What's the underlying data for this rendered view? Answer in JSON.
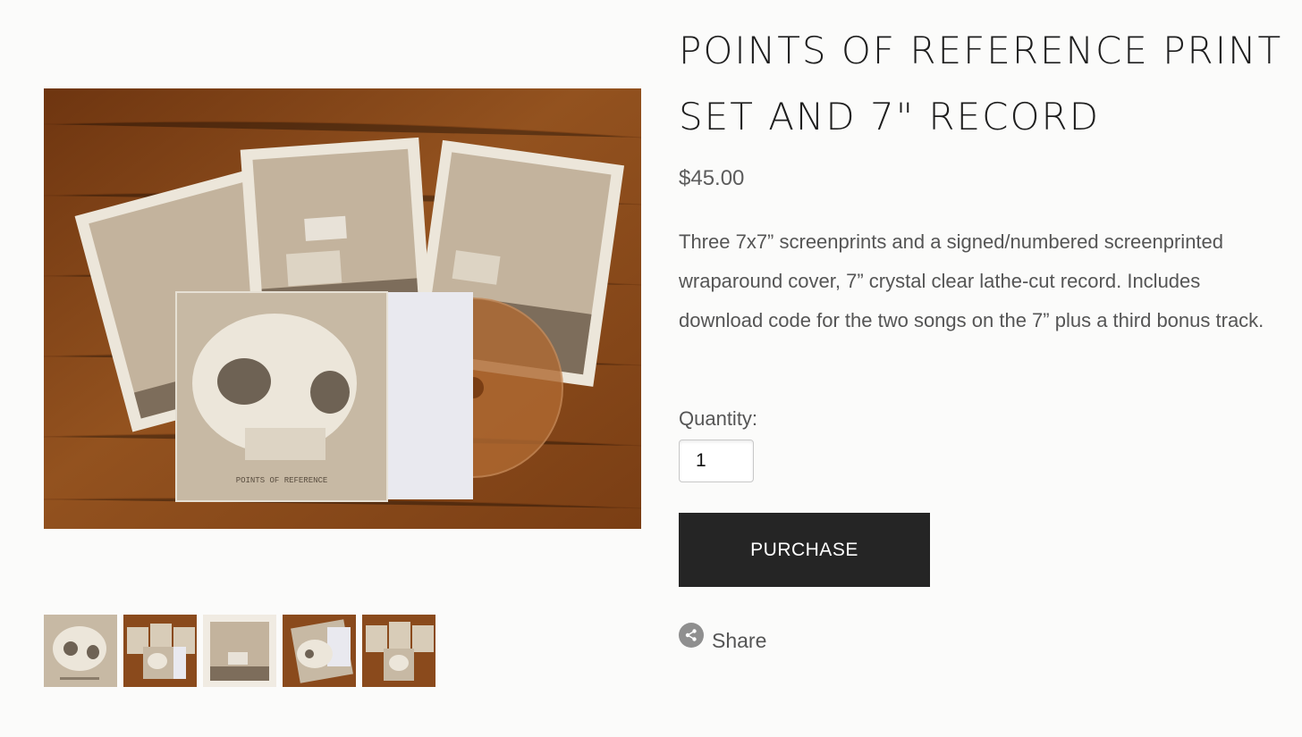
{
  "product": {
    "title": "POINTS OF REFERENCE PRINT SET AND 7\" RECORD",
    "price": "$45.00",
    "description": "Three 7x7” screenprints and a signed/numbered screenprinted wraparound cover, 7” crystal clear lathe-cut record. Includes download code for the two songs on the 7” plus a third bonus track.",
    "cover_text": "POINTS OF REFERENCE"
  },
  "quantity": {
    "label": "Quantity:",
    "value": "1"
  },
  "purchase_label": "PURCHASE",
  "share_label": "Share",
  "gallery": {
    "main_image": "product-photo-set-on-wooden-table",
    "thumbnails": [
      "skull-cover",
      "set-on-table",
      "water-tower-print",
      "cover-closeup",
      "set-on-table-alt"
    ]
  },
  "colors": {
    "button_bg": "#252525",
    "wood": "#8a4a1c",
    "print_tan": "#c2b29c"
  }
}
